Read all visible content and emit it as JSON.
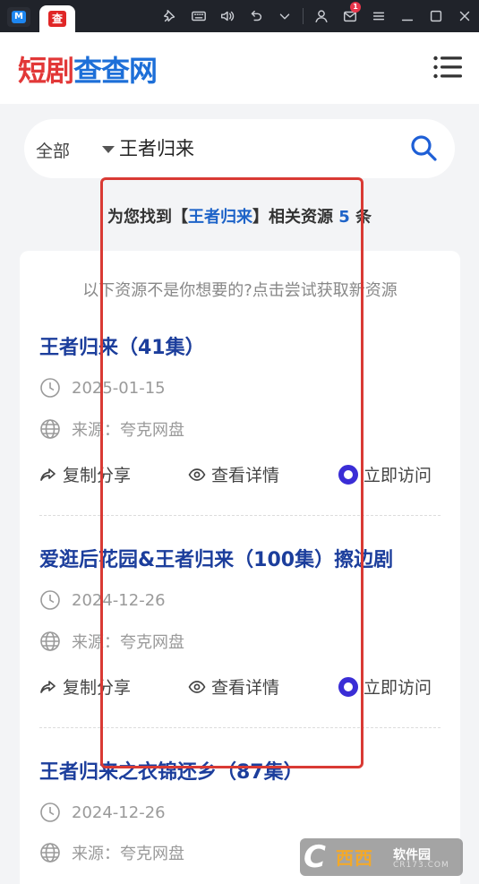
{
  "window": {
    "tab_active_logo": "查",
    "mail_badge": "1"
  },
  "header": {
    "brand_part1": "短剧",
    "brand_part2": "查查网"
  },
  "search": {
    "category": "全部",
    "query": "王者归来"
  },
  "result_summary": {
    "prefix": "为您找到【",
    "keyword": "王者归来",
    "middle": "】相关资源 ",
    "count": "5",
    "suffix": " 条"
  },
  "hint": "以下资源不是你想要的?点击尝试获取新资源",
  "items": [
    {
      "title": "王者归来（41集）",
      "date": "2025-01-15",
      "source": "来源：夸克网盘",
      "share": "复制分享",
      "details": "查看详情",
      "visit": "立即访问"
    },
    {
      "title": "爱逛后花园&王者归来（100集）擦边剧",
      "date": "2024-12-26",
      "source": "来源：夸克网盘",
      "share": "复制分享",
      "details": "查看详情",
      "visit": "立即访问"
    },
    {
      "title": "王者归来之衣锦还乡（87集）",
      "date": "2024-12-26",
      "source": "来源：夸克网盘"
    }
  ],
  "watermark": {
    "mark": "C",
    "name": "西西",
    "sub": "软件园",
    "domain": "CR173.COM"
  },
  "colors": {
    "title_blue": "#1c3e9c",
    "accent_blue": "#1d63c8",
    "brand_red": "#e23838",
    "annotation_red": "#d93a34",
    "visit_purple": "#3a2dd6"
  }
}
